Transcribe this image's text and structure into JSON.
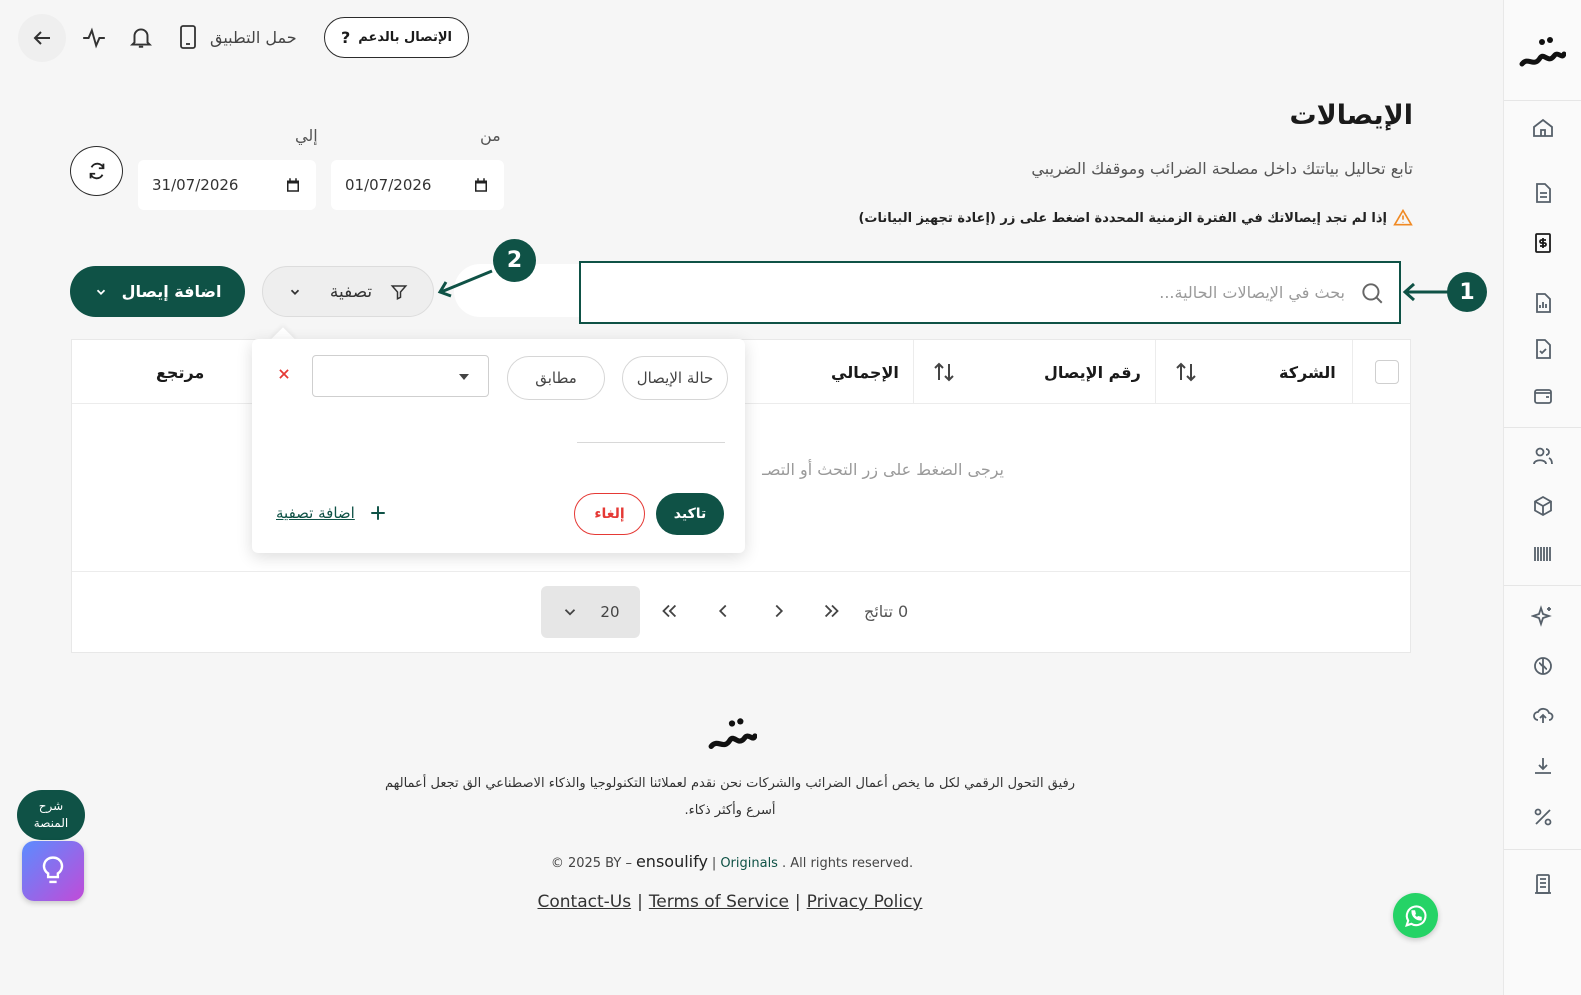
{
  "topbar": {
    "support_label": "الإتصال بالدعم",
    "support_icon": "?",
    "download_app_label": "حمل التطبيق"
  },
  "page": {
    "title": "الإيصالات",
    "subtitle": "تابع تحاليل بياتتك داخل مصلحة الضرائب وموقفك الضريبي",
    "warning": "إذا لم تجد إيصالاتك في الفترة الزمنية المحددة اضغط على زر (إعادة تجهيز البيانات)"
  },
  "dates": {
    "from_label": "من",
    "from_value": "01/07/2026",
    "to_label": "إلي",
    "to_value": "31/07/2026"
  },
  "actions": {
    "add_receipt": "اضافة إيصال",
    "filter": "تصفية",
    "search_placeholder": "بحث في الإيصالات الحالية..."
  },
  "callouts": {
    "one": "1",
    "two": "2"
  },
  "table": {
    "columns": [
      "الشركة",
      "رقم الإيصال",
      "الإجمالي",
      "مرتجع"
    ],
    "empty_text": "يرجى الضغط على زر التحث أو التصـ"
  },
  "filter_popup": {
    "field_chip": "حالة الإيصال",
    "operator_chip": "مطابق",
    "value_select": "",
    "confirm": "تاكيد",
    "cancel": "إلغاء",
    "add_filter": "اضافة تصفية"
  },
  "pagination": {
    "results": "0 تتائج",
    "page_size": "20"
  },
  "footer": {
    "tagline_1": "رفيق التحول الرقمي لكل ما يخص أعمال الضرائب والشركات نحن نقدم لعملائنا التكنولوجيا والذكاء الاصطناعي الق تجعل أعمالهم",
    "tagline_2": "أسرع وأكثر ذكاء.",
    "copyright_prefix": "© 2025 BY –",
    "brand": "ensoulify",
    "originals": "Originals",
    "rights": ". All rights reserved.",
    "contact": "Contact-Us",
    "terms": "Terms of Service",
    "privacy": "Privacy Policy"
  },
  "widgets": {
    "platform_help": "شرح المنصة"
  },
  "colors": {
    "brand": "#0f5246",
    "warning": "#f08a24",
    "danger": "#e53935",
    "whatsapp": "#25d366",
    "gradient_start": "#5b8cff",
    "gradient_end": "#c14bd8"
  }
}
